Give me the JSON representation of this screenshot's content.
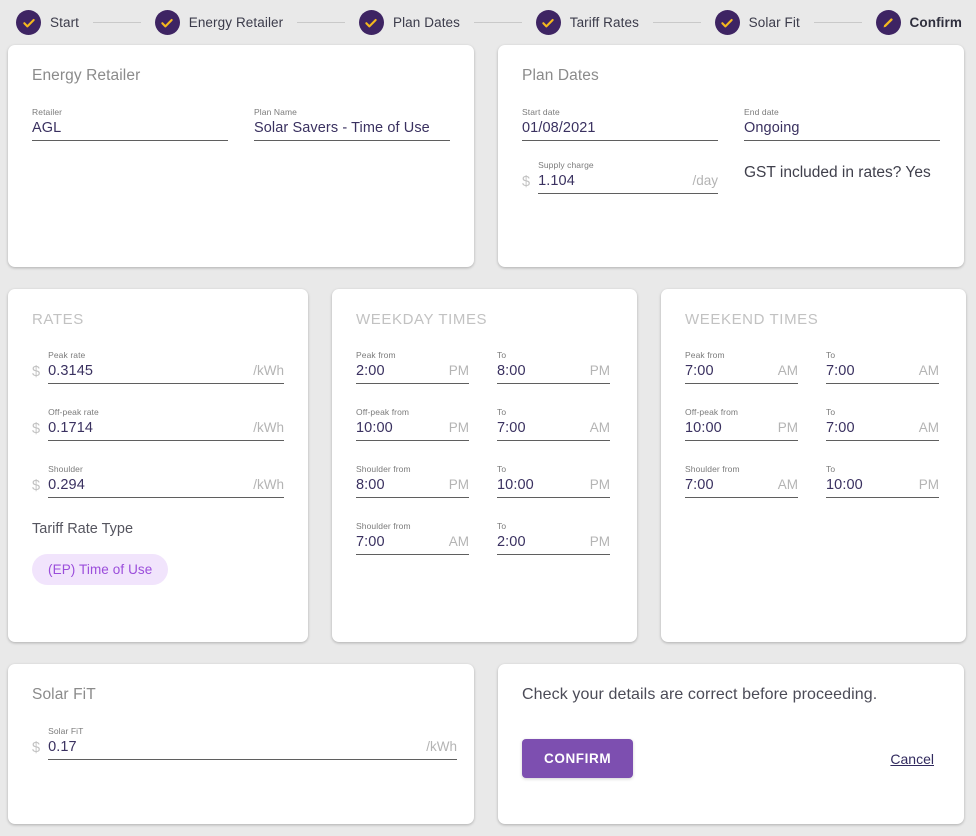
{
  "stepper": {
    "steps": [
      {
        "label": "Start",
        "icon": "check-icon",
        "state": "complete"
      },
      {
        "label": "Energy Retailer",
        "icon": "check-icon",
        "state": "complete"
      },
      {
        "label": "Plan Dates",
        "icon": "check-icon",
        "state": "complete"
      },
      {
        "label": "Tariff Rates",
        "icon": "check-icon",
        "state": "complete"
      },
      {
        "label": "Solar Fit",
        "icon": "check-icon",
        "state": "complete"
      },
      {
        "label": "Confirm",
        "icon": "pencil-icon",
        "state": "current"
      }
    ],
    "badge_color": "#3e2463",
    "icon_color": "#f5b81e",
    "connector_color": "#c9c9c9"
  },
  "energy_retailer": {
    "title": "Energy Retailer",
    "retailer": {
      "label": "Retailer",
      "value": "AGL"
    },
    "plan_name": {
      "label": "Plan Name",
      "value": "Solar Savers - Time of Use"
    }
  },
  "plan_dates": {
    "title": "Plan Dates",
    "start_date": {
      "label": "Start date",
      "value": "01/08/2021"
    },
    "end_date": {
      "label": "End date",
      "value": "Ongoing"
    },
    "supply_charge": {
      "label": "Supply charge",
      "prefix": "$",
      "value": "1.104",
      "suffix": "/day"
    },
    "gst_text": "GST included in rates? Yes"
  },
  "rates": {
    "title": "RATES",
    "items": [
      {
        "label": "Peak rate",
        "prefix": "$",
        "value": "0.3145",
        "suffix": "/kWh"
      },
      {
        "label": "Off-peak rate",
        "prefix": "$",
        "value": "0.1714",
        "suffix": "/kWh"
      },
      {
        "label": "Shoulder",
        "prefix": "$",
        "value": "0.294",
        "suffix": "/kWh"
      }
    ],
    "tariff_rate_type_heading": "Tariff Rate Type",
    "tariff_rate_type_chip": "(EP) Time of Use",
    "chip_bg": "#f1e4fc",
    "chip_fg": "#9b4ddb"
  },
  "weekday_times": {
    "title": "WEEKDAY TIMES",
    "items": [
      {
        "label": "Peak from",
        "value": "2:00",
        "suffix": "PM"
      },
      {
        "label": "To",
        "value": "8:00",
        "suffix": "PM"
      },
      {
        "label": "Off-peak from",
        "value": "10:00",
        "suffix": "PM"
      },
      {
        "label": "To",
        "value": "7:00",
        "suffix": "AM"
      },
      {
        "label": "Shoulder from",
        "value": "8:00",
        "suffix": "PM"
      },
      {
        "label": "To",
        "value": "10:00",
        "suffix": "PM"
      },
      {
        "label": "Shoulder from",
        "value": "7:00",
        "suffix": "AM"
      },
      {
        "label": "To",
        "value": "2:00",
        "suffix": "PM"
      }
    ]
  },
  "weekend_times": {
    "title": "WEEKEND TIMES",
    "items": [
      {
        "label": "Peak from",
        "value": "7:00",
        "suffix": "AM"
      },
      {
        "label": "To",
        "value": "7:00",
        "suffix": "AM"
      },
      {
        "label": "Off-peak from",
        "value": "10:00",
        "suffix": "PM"
      },
      {
        "label": "To",
        "value": "7:00",
        "suffix": "AM"
      },
      {
        "label": "Shoulder from",
        "value": "7:00",
        "suffix": "AM"
      },
      {
        "label": "To",
        "value": "10:00",
        "suffix": "PM"
      }
    ]
  },
  "solar_fit": {
    "title": "Solar FiT",
    "field": {
      "label": "Solar FiT",
      "prefix": "$",
      "value": "0.17",
      "suffix": "/kWh"
    }
  },
  "confirm_panel": {
    "message": "Check your details are correct before proceeding.",
    "confirm_label": "CONFIRM",
    "cancel_label": "Cancel",
    "confirm_color": "#7d4fb0"
  }
}
